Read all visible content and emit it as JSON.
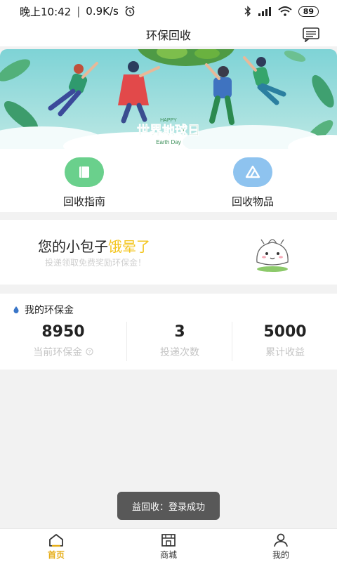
{
  "status_bar": {
    "time": "晚上10:42",
    "speed": "0.9K/s",
    "battery": "89"
  },
  "header": {
    "title": "环保回收"
  },
  "banner": {
    "small_text": "HAPPY",
    "title": "世界地球日",
    "subtitle": "Earth Day"
  },
  "quick_menu": [
    {
      "label": "回收指南",
      "icon": "book-icon",
      "color": "#6ad08c"
    },
    {
      "label": "回收物品",
      "icon": "drive-triangle-icon",
      "color": "#8ec3ef"
    }
  ],
  "promo": {
    "title_prefix": "您的小包子",
    "title_accent": "饿晕了",
    "subtitle": "投递领取免费奖励环保金！",
    "accent_color": "#f3c51f"
  },
  "wallet": {
    "heading": "我的环保金",
    "stats": [
      {
        "value": "8950",
        "label": "当前环保金"
      },
      {
        "value": "3",
        "label": "投递次数"
      },
      {
        "value": "5000",
        "label": "累计收益"
      }
    ]
  },
  "toast": {
    "text": "益回收：登录成功"
  },
  "tabbar": {
    "active_color": "#e6ae1a",
    "tabs": [
      {
        "label": "首页",
        "icon": "home-icon"
      },
      {
        "label": "商城",
        "icon": "shop-icon"
      },
      {
        "label": "我的",
        "icon": "user-icon"
      }
    ]
  }
}
